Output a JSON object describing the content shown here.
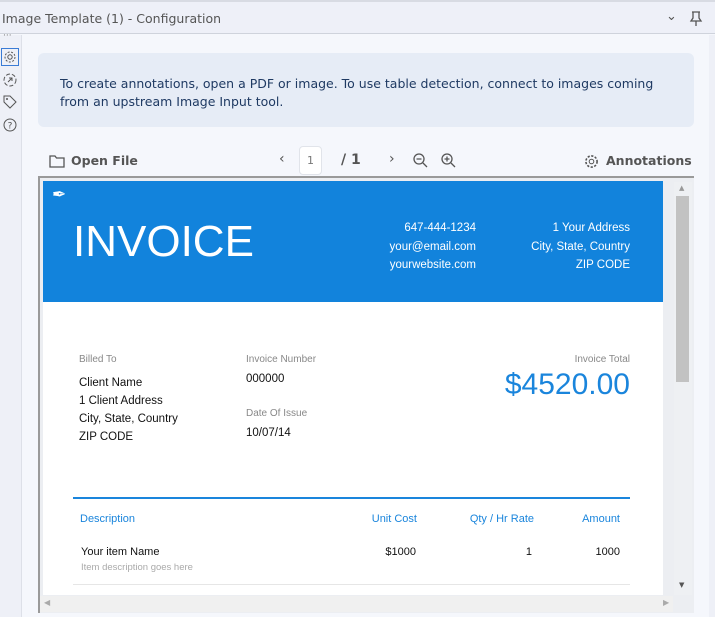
{
  "window": {
    "title": "Image Template (1) - Configuration"
  },
  "info": {
    "message": "To create annotations, open a PDF or image. To use table detection, connect to images coming from an upstream Image Input tool."
  },
  "toolbar": {
    "open_file": "Open File",
    "page": "1",
    "page_total": "/ 1",
    "annotations": "Annotations"
  },
  "invoice": {
    "title": "INVOICE",
    "phone": "647-444-1234",
    "email": "your@email.com",
    "website": "yourwebsite.com",
    "address1": "1 Your Address",
    "address2": "City, State, Country",
    "zip": "ZIP CODE",
    "billed_to_label": "Billed To",
    "client_name": "Client Name",
    "client_address": "1 Client Address",
    "client_city": "City, State, Country",
    "client_zip": "ZIP CODE",
    "invoice_number_label": "Invoice Number",
    "invoice_number": "000000",
    "date_label": "Date Of Issue",
    "date": "10/07/14",
    "total_label": "Invoice Total",
    "total": "$4520.00",
    "columns": [
      "Description",
      "Unit Cost",
      "Qty / Hr Rate",
      "Amount"
    ],
    "items": [
      {
        "name": "Your item Name",
        "desc": "Item description goes here",
        "unit_cost": "$1000",
        "qty": "1",
        "amount": "1000"
      }
    ]
  },
  "colors": {
    "accent": "#1283dc"
  }
}
